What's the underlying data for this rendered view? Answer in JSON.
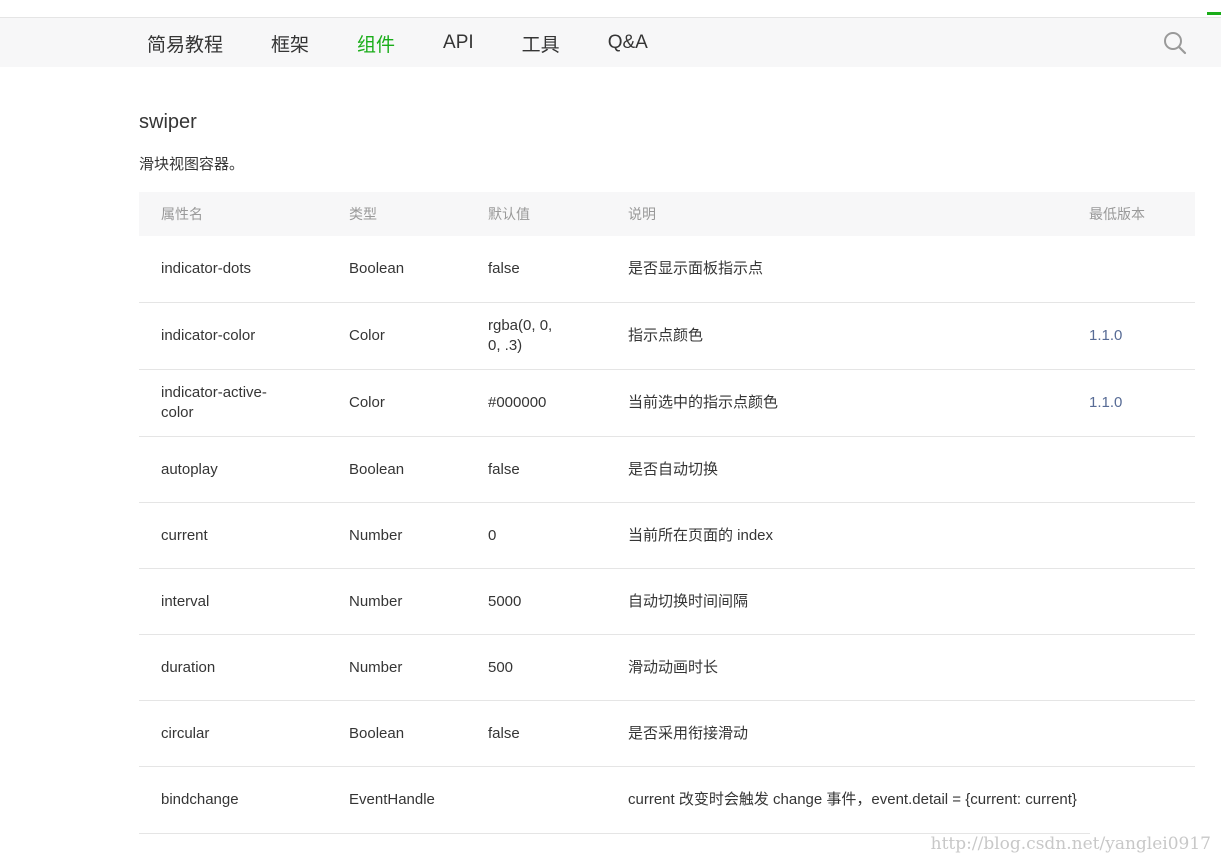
{
  "nav": {
    "items": [
      "简易教程",
      "框架",
      "组件",
      "API",
      "工具",
      "Q&A"
    ],
    "active_index": 2,
    "search_icon": "search-icon"
  },
  "page": {
    "title": "swiper",
    "description": "滑块视图容器。"
  },
  "table": {
    "headers": [
      "属性名",
      "类型",
      "默认值",
      "说明",
      "最低版本"
    ],
    "rows": [
      {
        "name": "indicator-dots",
        "type": "Boolean",
        "default": "false",
        "desc": "是否显示面板指示点",
        "version": ""
      },
      {
        "name": "indicator-color",
        "type": "Color",
        "default": "rgba(0, 0, 0, .3)",
        "desc": "指示点颜色",
        "version": "1.1.0"
      },
      {
        "name": "indicator-active-color",
        "type": "Color",
        "default": "#000000",
        "desc": "当前选中的指示点颜色",
        "version": "1.1.0"
      },
      {
        "name": "autoplay",
        "type": "Boolean",
        "default": "false",
        "desc": "是否自动切换",
        "version": ""
      },
      {
        "name": "current",
        "type": "Number",
        "default": "0",
        "desc": "当前所在页面的 index",
        "version": ""
      },
      {
        "name": "interval",
        "type": "Number",
        "default": "5000",
        "desc": "自动切换时间间隔",
        "version": ""
      },
      {
        "name": "duration",
        "type": "Number",
        "default": "500",
        "desc": "滑动动画时长",
        "version": ""
      },
      {
        "name": "circular",
        "type": "Boolean",
        "default": "false",
        "desc": "是否采用衔接滑动",
        "version": ""
      },
      {
        "name": "bindchange",
        "type": "EventHandle",
        "default": "",
        "desc": "current 改变时会触发 change 事件，event.detail = {current: current}",
        "version": ""
      }
    ]
  },
  "watermark": "http://blog.csdn.net/yanglei0917",
  "colors": {
    "accent": "#1aad19",
    "link": "#576b95",
    "header_bg": "#f7f7f8"
  }
}
